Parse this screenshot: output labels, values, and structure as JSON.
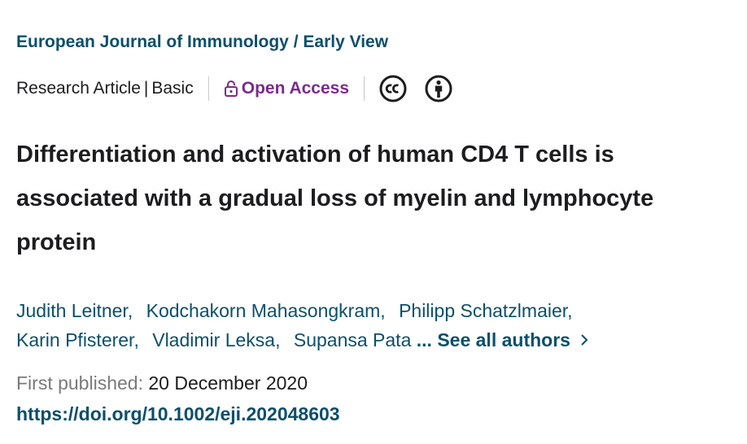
{
  "journal": {
    "name": "European Journal of Immunology",
    "separator": "/",
    "section": "Early View"
  },
  "meta": {
    "article_type": "Research Article",
    "pipe": "|",
    "category": "Basic",
    "access": "Open Access",
    "access_color": "#7b2b8c",
    "license_icons": [
      "creative-commons-icon",
      "attribution-icon"
    ]
  },
  "article": {
    "title_lines": [
      "Differentiation and activation of human CD4 T cells is",
      "associated with a gradual loss of myelin and lymphocyte",
      "protein"
    ]
  },
  "authors": {
    "list": [
      "Judith Leitner",
      "Kodchakorn Mahasongkram",
      "Philipp Schatzlmaier",
      "Karin Pfisterer",
      "Vladimir Leksa",
      "Supansa Pata"
    ],
    "separator": ",",
    "see_all": "... See all authors"
  },
  "publication": {
    "label": "First published:",
    "date": "20 December 2020",
    "doi": "https://doi.org/10.1002/eji.202048603"
  },
  "colors": {
    "link": "#0b4f6c",
    "text": "#1c1d1e",
    "muted": "#7a7a7a"
  }
}
